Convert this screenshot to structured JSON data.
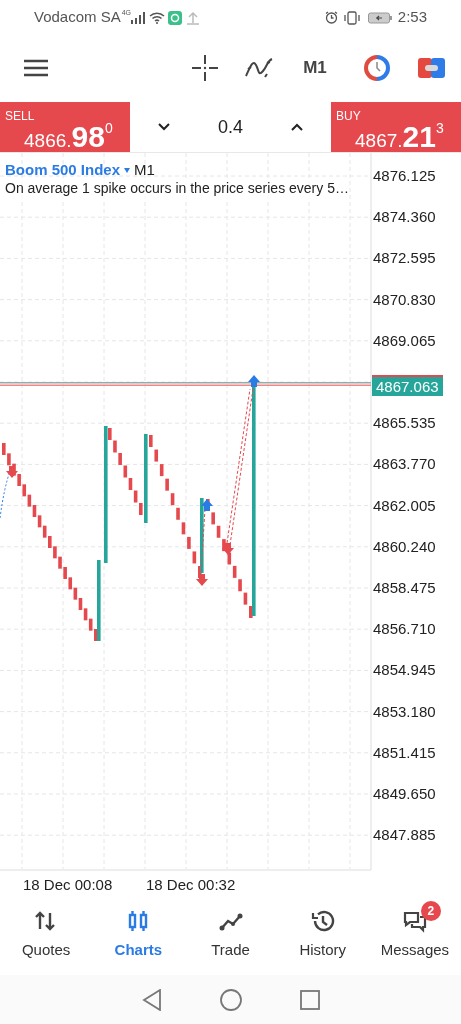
{
  "status_bar": {
    "carrier": "Vodacom SA",
    "network": "4G",
    "time": "2:53"
  },
  "toolbar": {
    "timeframe": "M1"
  },
  "trade_panel": {
    "sell": {
      "label": "SELL",
      "price": "4866.**98**$^{0}$"
    },
    "volume": "0.4",
    "buy": {
      "label": "BUY",
      "price": "4867.**21**$^{3}$"
    }
  },
  "chart": {
    "symbol": "Boom 500 Index",
    "timeframe": "M1",
    "description": "On average 1 spike occurs in the price series every 5…",
    "price_scale": [
      "4876.125",
      "4874.360",
      "4872.595",
      "4870.830",
      "4869.065",
      "4865.535",
      "4863.770",
      "4862.005",
      "4860.240",
      "4858.475",
      "4856.710",
      "4854.945",
      "4853.180",
      "4851.415",
      "4849.650",
      "4847.885"
    ],
    "current_price": "4867.063",
    "time_scale": [
      "18 Dec 00:08",
      "18 Dec 00:32"
    ]
  },
  "bottom_nav": [
    {
      "label": "Quotes",
      "selected": false
    },
    {
      "label": "Charts",
      "selected": true
    },
    {
      "label": "Trade",
      "selected": false
    },
    {
      "label": "History",
      "selected": false
    },
    {
      "label": "Messages",
      "selected": false,
      "badge": "2"
    }
  ]
}
